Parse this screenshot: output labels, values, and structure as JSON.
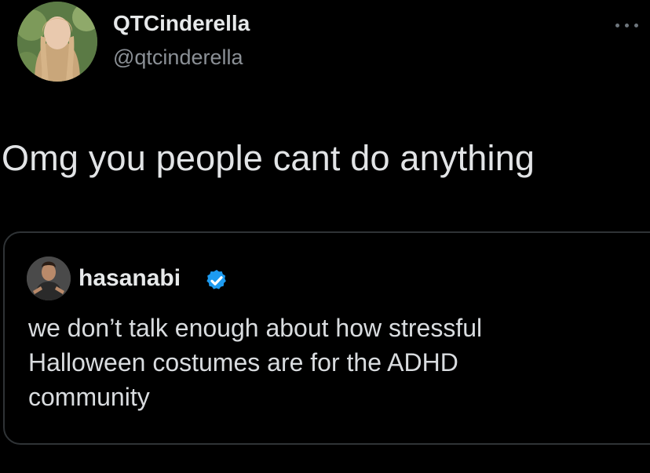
{
  "tweet": {
    "author": {
      "display_name": "QTCinderella",
      "handle": "@qtcinderella",
      "avatar_icon": "user-avatar-photo"
    },
    "more_icon": "more-options-icon",
    "text": "Omg you people cant do anything"
  },
  "quoted_tweet": {
    "author": {
      "display_name": "hasanabi",
      "verified": true,
      "avatar_icon": "user-avatar-photo"
    },
    "verified_icon": "verified-badge-icon",
    "text_lines": [
      "we don’t talk enough about how stressful",
      "Halloween costumes are for the ADHD",
      "community"
    ]
  },
  "colors": {
    "background": "#000000",
    "primary_text": "#e7e9ea",
    "secondary_text": "#8b9096",
    "border": "#2f3336",
    "verified_blue": "#1d9bf0"
  }
}
